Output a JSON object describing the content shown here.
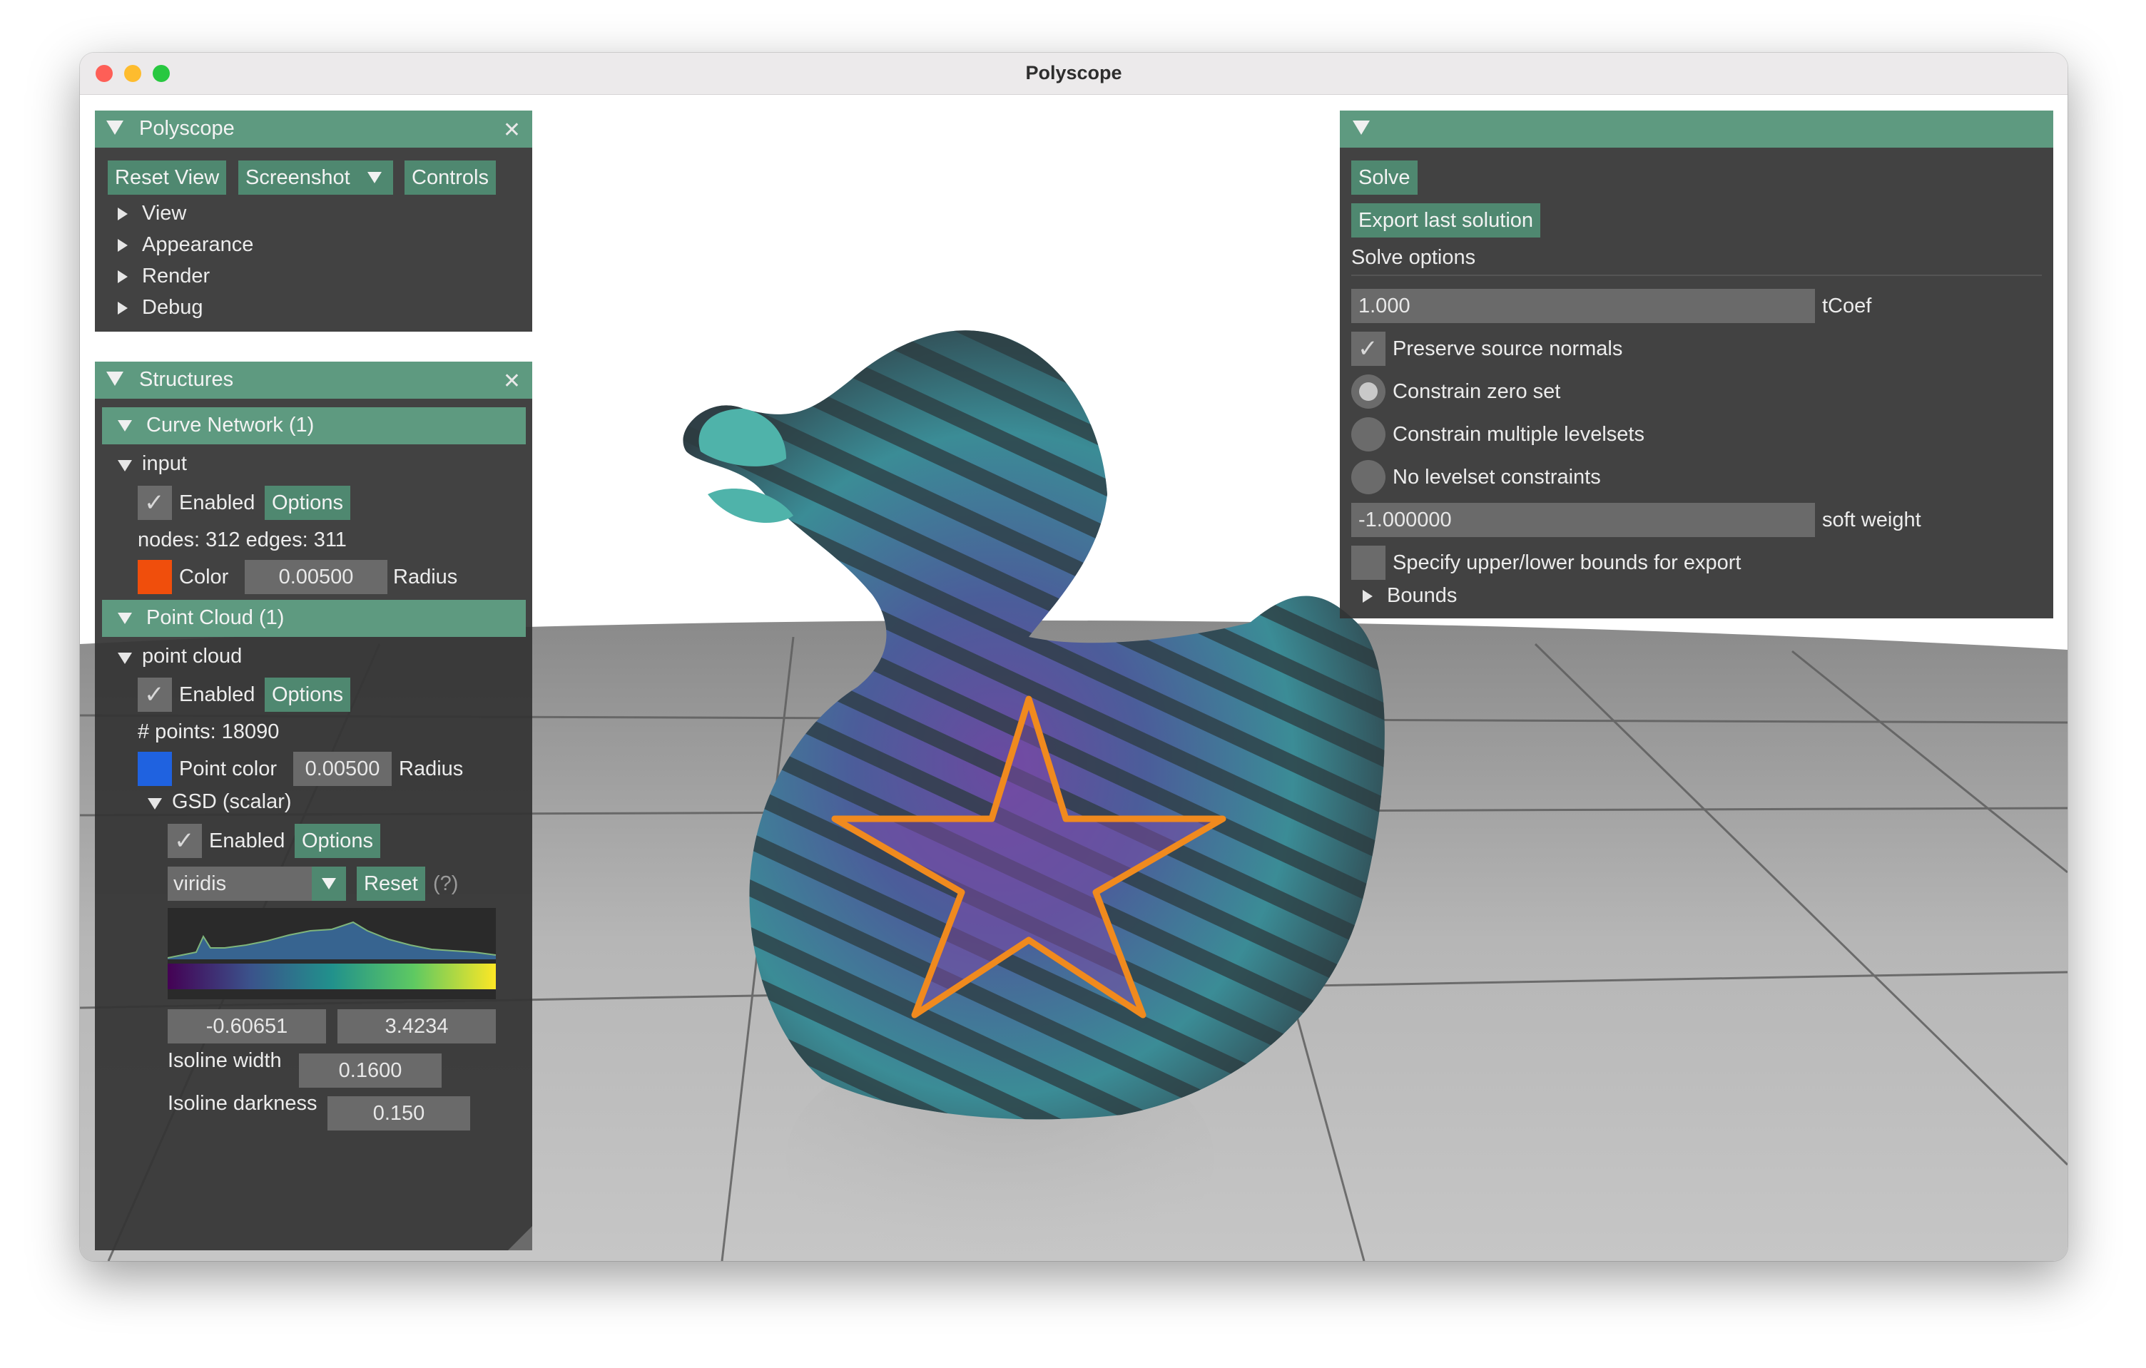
{
  "window": {
    "title": "Polyscope"
  },
  "polyscope_panel": {
    "title": "Polyscope",
    "buttons": {
      "reset_view": "Reset View",
      "screenshot": "Screenshot",
      "controls": "Controls"
    },
    "sections": [
      "View",
      "Appearance",
      "Render",
      "Debug"
    ]
  },
  "structures_panel": {
    "title": "Structures",
    "curve_network": {
      "header": "Curve Network (1)",
      "item": "input",
      "enabled_label": "Enabled",
      "options_label": "Options",
      "stats": "nodes: 312  edges: 311",
      "color_label": "Color",
      "color": "#f04e0c",
      "radius_value": "0.00500",
      "radius_label": "Radius"
    },
    "point_cloud": {
      "header": "Point Cloud (1)",
      "item": "point cloud",
      "enabled_label": "Enabled",
      "options_label": "Options",
      "stats": "# points: 18090",
      "color_label": "Point color",
      "color": "#1f62e0",
      "radius_value": "0.00500",
      "radius_label": "Radius",
      "quantity": {
        "header": "GSD (scalar)",
        "enabled_label": "Enabled",
        "options_label": "Options",
        "colormap": "viridis",
        "reset_label": "Reset",
        "help": "(?)",
        "range_min": "-0.60651",
        "range_max": "3.4234",
        "isoline_width_label": "Isoline width",
        "isoline_width_value": "0.1600",
        "isoline_darkness_label": "Isoline darkness",
        "isoline_darkness_value": "0.150"
      }
    }
  },
  "solver_panel": {
    "solve_label": "Solve",
    "export_label": "Export last solution",
    "options_heading": "Solve options",
    "tcoef_value": "1.000",
    "tcoef_label": "tCoef",
    "preserve_normals_label": "Preserve source normals",
    "radio_zero_set": "Constrain zero set",
    "radio_multiple": "Constrain multiple levelsets",
    "radio_none": "No levelset constraints",
    "soft_weight_value": "-1.000000",
    "soft_weight_label": "soft weight",
    "bounds_checkbox_label": "Specify upper/lower bounds for export",
    "bounds_label": "Bounds"
  },
  "colors": {
    "accent": "#5e9a80",
    "button": "#4f8870",
    "panel_bg": "#343434",
    "star_curve": "#f08a1e"
  },
  "icons": {
    "close": "close-icon",
    "collapse": "triangle-down-icon",
    "expand": "triangle-right-icon",
    "check": "checkmark-icon",
    "dropdown": "dropdown-arrow-icon"
  }
}
